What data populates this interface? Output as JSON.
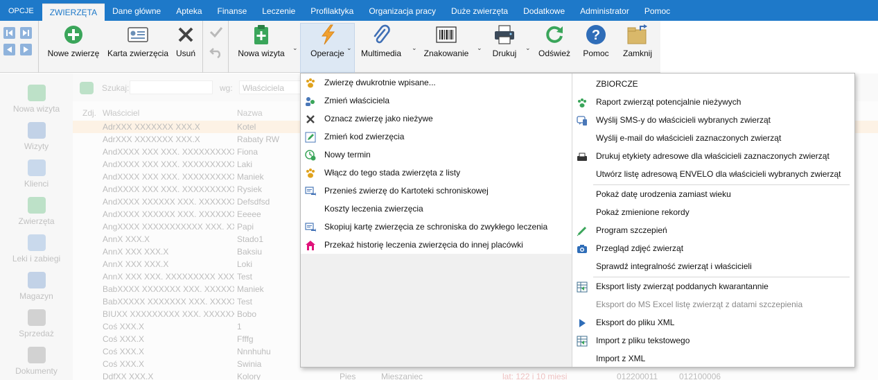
{
  "menubar": {
    "items": [
      "OPCJE",
      "ZWIERZĘTA",
      "Dane główne",
      "Apteka",
      "Finanse",
      "Leczenie",
      "Profilaktyka",
      "Organizacja pracy",
      "Duże zwierzęta",
      "Dodatkowe",
      "Administrator",
      "Pomoc"
    ],
    "active_index": 1
  },
  "ribbon": {
    "new_animal": "Nowe zwierzę",
    "animal_card": "Karta zwierzęcia",
    "delete": "Usuń",
    "new_visit": "Nowa wizyta",
    "operations": "Operacje",
    "multimedia": "Multimedia",
    "marking": "Znakowanie",
    "print": "Drukuj",
    "refresh": "Odśwież",
    "help": "Pomoc",
    "close": "Zamknij"
  },
  "background": {
    "sidebar": [
      "Nowa wizyta",
      "Wizyty",
      "Klienci",
      "Zwierzęta",
      "Leki i zabiegi",
      "Magazyn",
      "Sprzedaż",
      "Dokumenty"
    ],
    "search_label": "Szukaj:",
    "search_by_label": "wg:",
    "search_by_value": "Właściciela",
    "columns": [
      "Zdj.",
      "Właściciel",
      "Nazwa"
    ],
    "rows": [
      [
        "AdrXXX XXXXXXX XXX.X",
        "Kotel"
      ],
      [
        "AdrXXX XXXXXXX XXX.X",
        "Rabaty RW"
      ],
      [
        "AndXXXX XXX XXX. XXXXXXXXXXXXX",
        "Fiona"
      ],
      [
        "AndXXXX XXX XXX. XXXXXXXXXXXXX",
        "Laki"
      ],
      [
        "AndXXXX XXX XXX. XXXXXXXXXXXXX",
        "Maniek"
      ],
      [
        "AndXXXX XXX XXX. XXXXXXXXXXXXX",
        "Rysiek"
      ],
      [
        "AndXXXX XXXXXX XXX. XXXXXXXXXXX",
        "Defsdfsd"
      ],
      [
        "AndXXXX XXXXXX XXX. XXXXXXXXXXX",
        "Eeeee"
      ],
      [
        "AngXXXX XXXXXXXXXXX XXX. XXX",
        "Papi"
      ],
      [
        "AnnX XXX.X",
        "Stado1"
      ],
      [
        "AnnX XXX XXX.X",
        "Baksiu"
      ],
      [
        "AnnX XXX XXX.X",
        "Loki"
      ],
      [
        "AnnX XXX XXX. XXXXXXXXX XXX",
        "Test"
      ],
      [
        "BabXXXX XXXXXXX XXX. XXXXXXX",
        "Maniek"
      ],
      [
        "BabXXXXX XXXXXXX XXX. XXXXXXX",
        "Test"
      ],
      [
        "BIUXX XXXXXXXXX XXX. XXXXXXX",
        "Bobo"
      ],
      [
        "Coś XXX.X",
        "1"
      ],
      [
        "Coś XXX.X",
        "Ffffg"
      ],
      [
        "Coś XXX.X",
        "Nnnhuhu"
      ],
      [
        "Coś XXX.X",
        "Swinia"
      ],
      [
        "DdfXX XXX.X",
        "Kolory"
      ]
    ],
    "bottom": [
      "Pies",
      "Mieszaniec",
      "lat: 122 i 10 miesi",
      "012200011",
      "012100006"
    ]
  },
  "dropdown": {
    "left": [
      {
        "label": "Zwierzę dwukrotnie wpisane...",
        "icon": "paw-gold-icon"
      },
      {
        "label": "Zmień właściciela",
        "icon": "people-swap-icon"
      },
      {
        "label": "Oznacz zwierzę jako nieżywe",
        "icon": "x-mark-icon"
      },
      {
        "label": "Zmień kod zwierzęcia",
        "icon": "pencil-icon"
      },
      {
        "label": "Nowy termin",
        "icon": "clock-plus-icon"
      },
      {
        "label": "Włącz do tego stada zwierzęta z listy",
        "icon": "paw-gold-icon"
      },
      {
        "label": "Przenieś zwierzę do Kartoteki schroniskowej",
        "icon": "transfer-icon"
      },
      {
        "label": "Koszty leczenia zwierzęcia",
        "icon": ""
      },
      {
        "label": "Skopiuj kartę zwierzęcia ze schroniska do zwykłego leczenia",
        "icon": "transfer-icon"
      },
      {
        "label": "Przekaż historię leczenia zwierzęcia do innej placówki",
        "icon": "house-icon"
      }
    ],
    "right_group1": [
      {
        "label": "ZBIORCZE",
        "icon": ""
      },
      {
        "label": "Raport zwierząt potencjalnie nieżywych",
        "icon": "paw-green-icon"
      },
      {
        "label": "Wyślij SMS-y do właścicieli wybranych zwierząt",
        "icon": "sms-icon"
      },
      {
        "label": "Wyślij e-mail do właścicieli zaznaczonych zwierząt",
        "icon": ""
      },
      {
        "label": "Drukuj etykiety adresowe dla właścicieli zaznaczonych zwierząt",
        "icon": "label-printer-icon"
      },
      {
        "label": "Utwórz listę adresową ENVELO dla właścicieli wybranych zwierząt",
        "icon": ""
      }
    ],
    "right_group2": [
      {
        "label": "Pokaż datę urodzenia zamiast wieku",
        "icon": ""
      },
      {
        "label": "Pokaż zmienione rekordy",
        "icon": ""
      },
      {
        "label": "Program szczepień",
        "icon": "syringe-icon"
      },
      {
        "label": "Przegląd zdjęć zwierząt",
        "icon": "camera-icon"
      },
      {
        "label": "Sprawdź integralność zwierząt i właścicieli",
        "icon": ""
      }
    ],
    "right_group3": [
      {
        "label": "Eksport listy zwierząt poddanych kwarantannie",
        "icon": "export-icon",
        "disabled": false
      },
      {
        "label": "Eksport do MS Excel listę zwierząt z datami szczepienia",
        "icon": "",
        "disabled": true
      },
      {
        "label": "Eksport do pliku XML",
        "icon": "play-icon",
        "disabled": false
      },
      {
        "label": "Import z pliku tekstowego",
        "icon": "export-icon",
        "disabled": false
      },
      {
        "label": "Import z XML",
        "icon": "",
        "disabled": false
      }
    ]
  },
  "colors": {
    "menubar": "#1e79c9",
    "ribbon": "#f4f4f4",
    "pressed": "#dde8f4",
    "selected_row": "#f9d9b2"
  }
}
